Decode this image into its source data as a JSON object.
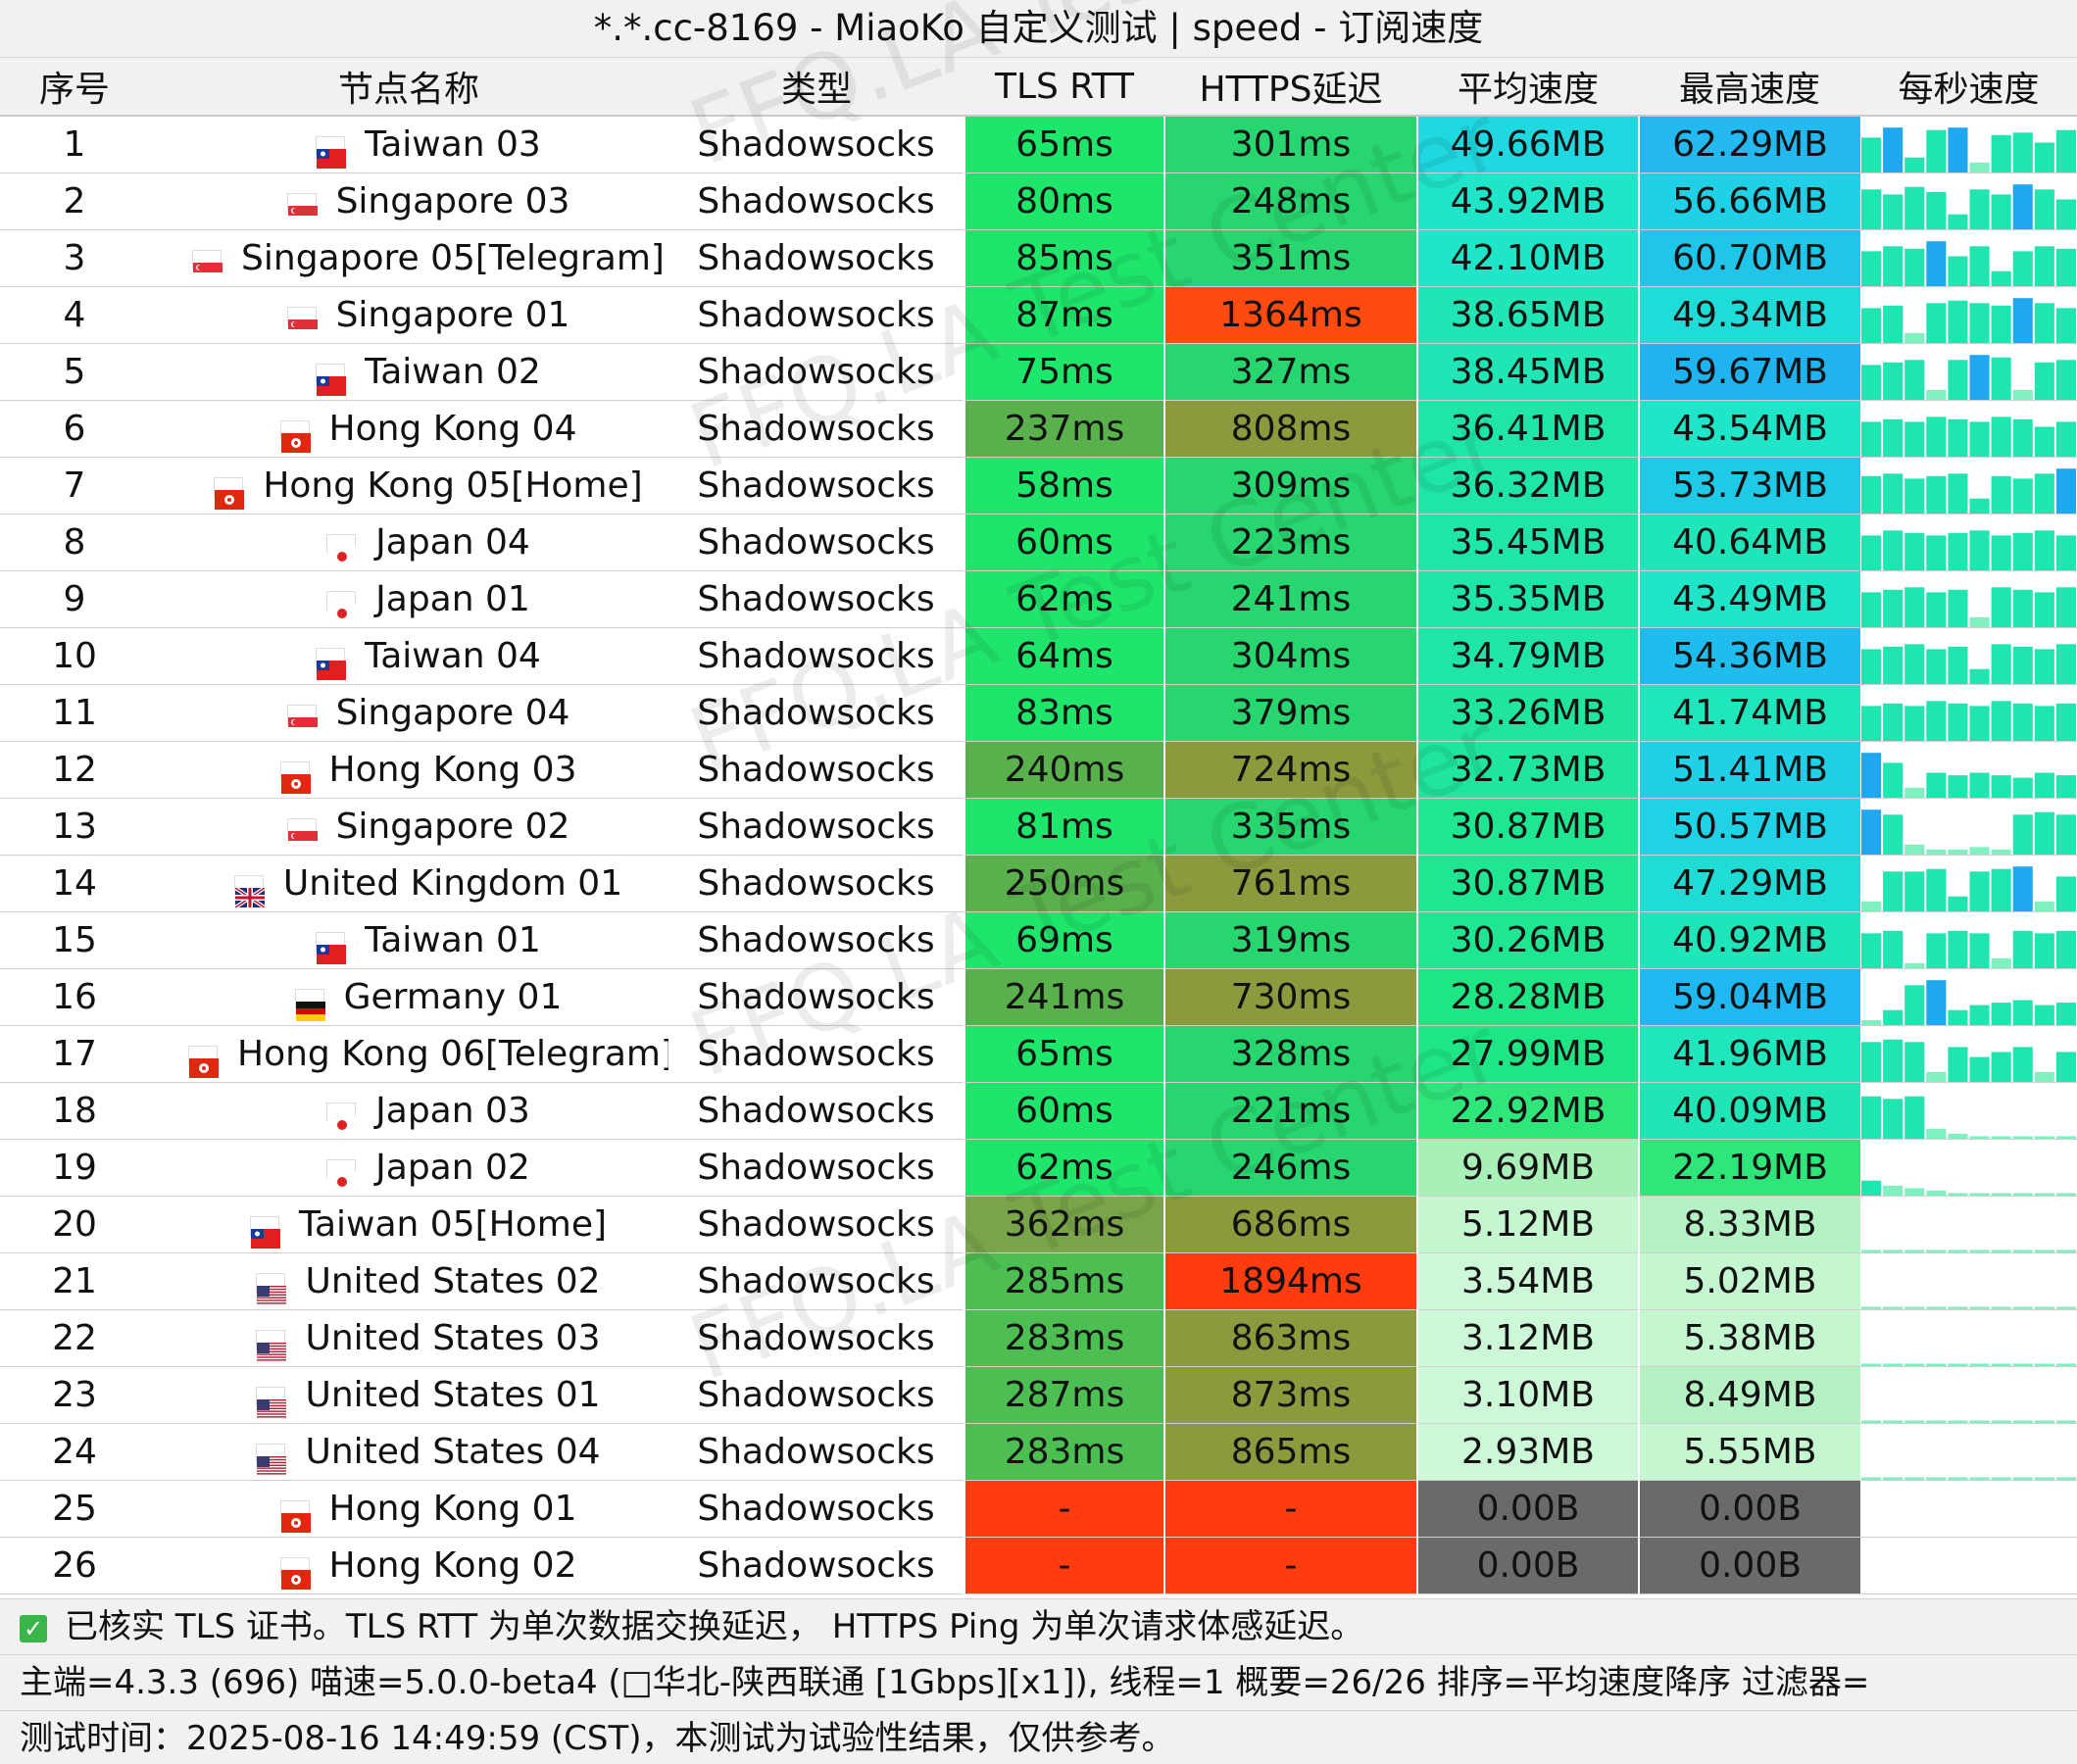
{
  "window": {
    "title": "*.*.cc-8169 - MiaoKo 自定义测试 | speed - 订阅速度"
  },
  "table": {
    "headers": [
      "序号",
      "节点名称",
      "类型",
      "TLS RTT",
      "HTTPS延迟",
      "平均速度",
      "最高速度",
      "每秒速度"
    ],
    "rows": [
      {
        "no": "1",
        "flag": "tw",
        "name": "Taiwan 03",
        "type": "Shadowsocks",
        "tls": "65ms",
        "https": "301ms",
        "avg": "49.66MB",
        "max": "62.29MB",
        "tls_color": "#1ee66b",
        "https_color": "#27d66e",
        "avg_color": "#1fd8e0",
        "max_color": "#24b9f0",
        "spark": [
          0.7,
          0.9,
          0.3,
          0.85,
          0.9,
          0.2,
          0.75,
          0.8,
          0.6,
          0.85
        ]
      },
      {
        "no": "2",
        "flag": "sg",
        "name": "Singapore 03",
        "type": "Shadowsocks",
        "tls": "80ms",
        "https": "248ms",
        "avg": "43.92MB",
        "max": "56.66MB",
        "tls_color": "#1ee66b",
        "https_color": "#27d66e",
        "avg_color": "#1fe6c8",
        "max_color": "#1fd0e6",
        "spark": [
          0.8,
          0.7,
          0.85,
          0.75,
          0.3,
          0.8,
          0.7,
          0.9,
          0.8,
          0.6
        ]
      },
      {
        "no": "3",
        "flag": "sg",
        "name": "Singapore 05[Telegram]",
        "type": "Shadowsocks",
        "tls": "85ms",
        "https": "351ms",
        "avg": "42.10MB",
        "max": "60.70MB",
        "tls_color": "#1ee66b",
        "https_color": "#27d66e",
        "avg_color": "#1fe6c8",
        "max_color": "#1fc6ea",
        "spark": [
          0.7,
          0.8,
          0.75,
          0.9,
          0.6,
          0.8,
          0.3,
          0.7,
          0.8,
          0.75
        ]
      },
      {
        "no": "4",
        "flag": "sg",
        "name": "Singapore 01",
        "type": "Shadowsocks",
        "tls": "87ms",
        "https": "1364ms",
        "avg": "38.65MB",
        "max": "49.34MB",
        "tls_color": "#1ee66b",
        "https_color": "#ff4a10",
        "avg_color": "#1fe6b4",
        "max_color": "#1fdcd8",
        "spark": [
          0.7,
          0.75,
          0.2,
          0.8,
          0.85,
          0.8,
          0.75,
          0.9,
          0.8,
          0.7
        ]
      },
      {
        "no": "5",
        "flag": "tw",
        "name": "Taiwan 02",
        "type": "Shadowsocks",
        "tls": "75ms",
        "https": "327ms",
        "avg": "38.45MB",
        "max": "59.67MB",
        "tls_color": "#1ee66b",
        "https_color": "#27d66e",
        "avg_color": "#1fe6b4",
        "max_color": "#1fb4f0",
        "spark": [
          0.7,
          0.75,
          0.8,
          0.2,
          0.8,
          0.9,
          0.85,
          0.2,
          0.75,
          0.8
        ]
      },
      {
        "no": "6",
        "flag": "hk",
        "name": "Hong Kong 04",
        "type": "Shadowsocks",
        "tls": "237ms",
        "https": "808ms",
        "avg": "36.41MB",
        "max": "43.54MB",
        "tls_color": "#5ab04c",
        "https_color": "#8c9a3e",
        "avg_color": "#1fe6a8",
        "max_color": "#1fe6c8",
        "spark": [
          0.7,
          0.75,
          0.7,
          0.8,
          0.75,
          0.7,
          0.8,
          0.75,
          0.6,
          0.7
        ]
      },
      {
        "no": "7",
        "flag": "hk",
        "name": "Hong Kong 05[Home]",
        "type": "Shadowsocks",
        "tls": "58ms",
        "https": "309ms",
        "avg": "36.32MB",
        "max": "53.73MB",
        "tls_color": "#1ee66b",
        "https_color": "#27d66e",
        "avg_color": "#1fe6a8",
        "max_color": "#1fcae6",
        "spark": [
          0.75,
          0.8,
          0.7,
          0.75,
          0.8,
          0.3,
          0.75,
          0.7,
          0.8,
          0.9
        ]
      },
      {
        "no": "8",
        "flag": "jp",
        "name": "Japan 04",
        "type": "Shadowsocks",
        "tls": "60ms",
        "https": "223ms",
        "avg": "35.45MB",
        "max": "40.64MB",
        "tls_color": "#1ee66b",
        "https_color": "#27d66e",
        "avg_color": "#1fe6a8",
        "max_color": "#1fe6b8",
        "spark": [
          0.7,
          0.8,
          0.75,
          0.7,
          0.75,
          0.8,
          0.7,
          0.75,
          0.8,
          0.7
        ]
      },
      {
        "no": "9",
        "flag": "jp",
        "name": "Japan 01",
        "type": "Shadowsocks",
        "tls": "62ms",
        "https": "241ms",
        "avg": "35.35MB",
        "max": "43.49MB",
        "tls_color": "#1ee66b",
        "https_color": "#27d66e",
        "avg_color": "#1fe6a8",
        "max_color": "#1fe6c8",
        "spark": [
          0.7,
          0.75,
          0.8,
          0.7,
          0.75,
          0.2,
          0.8,
          0.75,
          0.7,
          0.8
        ]
      },
      {
        "no": "10",
        "flag": "tw",
        "name": "Taiwan 04",
        "type": "Shadowsocks",
        "tls": "64ms",
        "https": "304ms",
        "avg": "34.79MB",
        "max": "54.36MB",
        "tls_color": "#1ee66b",
        "https_color": "#27d66e",
        "avg_color": "#1fe6a8",
        "max_color": "#1fbcee",
        "spark": [
          0.7,
          0.75,
          0.8,
          0.7,
          0.75,
          0.3,
          0.8,
          0.75,
          0.7,
          0.8
        ]
      },
      {
        "no": "11",
        "flag": "sg",
        "name": "Singapore 04",
        "type": "Shadowsocks",
        "tls": "83ms",
        "https": "379ms",
        "avg": "33.26MB",
        "max": "41.74MB",
        "tls_color": "#1ee66b",
        "https_color": "#27d66e",
        "avg_color": "#1fe69c",
        "max_color": "#1fe6bc",
        "spark": [
          0.7,
          0.75,
          0.7,
          0.8,
          0.75,
          0.7,
          0.8,
          0.75,
          0.7,
          0.75
        ]
      },
      {
        "no": "12",
        "flag": "hk",
        "name": "Hong Kong 03",
        "type": "Shadowsocks",
        "tls": "240ms",
        "https": "724ms",
        "avg": "32.73MB",
        "max": "51.41MB",
        "tls_color": "#5ab04c",
        "https_color": "#8c9a3e",
        "avg_color": "#1fe69c",
        "max_color": "#1fd0e6",
        "spark": [
          0.9,
          0.7,
          0.2,
          0.5,
          0.45,
          0.5,
          0.45,
          0.4,
          0.5,
          0.45
        ]
      },
      {
        "no": "13",
        "flag": "sg",
        "name": "Singapore 02",
        "type": "Shadowsocks",
        "tls": "81ms",
        "https": "335ms",
        "avg": "30.87MB",
        "max": "50.57MB",
        "tls_color": "#1ee66b",
        "https_color": "#27d66e",
        "avg_color": "#1fe690",
        "max_color": "#1fd2e6",
        "spark": [
          0.9,
          0.8,
          0.2,
          0.1,
          0.1,
          0.15,
          0.1,
          0.8,
          0.85,
          0.8
        ]
      },
      {
        "no": "14",
        "flag": "uk",
        "name": "United Kingdom 01",
        "type": "Shadowsocks",
        "tls": "250ms",
        "https": "761ms",
        "avg": "30.87MB",
        "max": "47.29MB",
        "tls_color": "#5ab04c",
        "https_color": "#8c9a3e",
        "avg_color": "#1fe690",
        "max_color": "#1fdcd4",
        "spark": [
          0.2,
          0.8,
          0.8,
          0.85,
          0.3,
          0.8,
          0.85,
          0.9,
          0.2,
          0.7
        ]
      },
      {
        "no": "15",
        "flag": "tw",
        "name": "Taiwan 01",
        "type": "Shadowsocks",
        "tls": "69ms",
        "https": "319ms",
        "avg": "30.26MB",
        "max": "40.92MB",
        "tls_color": "#1ee66b",
        "https_color": "#27d66e",
        "avg_color": "#1fe690",
        "max_color": "#1fe6b8",
        "spark": [
          0.7,
          0.75,
          0.1,
          0.7,
          0.75,
          0.7,
          0.2,
          0.75,
          0.7,
          0.75
        ]
      },
      {
        "no": "16",
        "flag": "de",
        "name": "Germany 01",
        "type": "Shadowsocks",
        "tls": "241ms",
        "https": "730ms",
        "avg": "28.28MB",
        "max": "59.04MB",
        "tls_color": "#5ab04c",
        "https_color": "#8c9a3e",
        "avg_color": "#1fe684",
        "max_color": "#1fb8f0",
        "spark": [
          0.1,
          0.3,
          0.8,
          0.9,
          0.3,
          0.4,
          0.45,
          0.5,
          0.4,
          0.45
        ]
      },
      {
        "no": "17",
        "flag": "hk",
        "name": "Hong Kong 06[Telegram]",
        "type": "Shadowsocks",
        "tls": "65ms",
        "https": "328ms",
        "avg": "27.99MB",
        "max": "41.96MB",
        "tls_color": "#1ee66b",
        "https_color": "#27d66e",
        "avg_color": "#1fe684",
        "max_color": "#1fe6bc",
        "spark": [
          0.8,
          0.85,
          0.8,
          0.2,
          0.7,
          0.5,
          0.6,
          0.7,
          0.2,
          0.6
        ]
      },
      {
        "no": "18",
        "flag": "jp",
        "name": "Japan 03",
        "type": "Shadowsocks",
        "tls": "60ms",
        "https": "221ms",
        "avg": "22.92MB",
        "max": "40.09MB",
        "tls_color": "#1ee66b",
        "https_color": "#27d66e",
        "avg_color": "#2fe67a",
        "max_color": "#1fe6b4",
        "spark": [
          0.85,
          0.8,
          0.85,
          0.2,
          0.1,
          0.05,
          0.05,
          0.05,
          0.05,
          0.05
        ]
      },
      {
        "no": "19",
        "flag": "jp",
        "name": "Japan 02",
        "type": "Shadowsocks",
        "tls": "62ms",
        "https": "246ms",
        "avg": "9.69MB",
        "max": "22.19MB",
        "tls_color": "#1ee66b",
        "https_color": "#27d66e",
        "avg_color": "#a8f0b8",
        "max_color": "#2fe67a",
        "spark": [
          0.3,
          0.2,
          0.15,
          0.1,
          0.05,
          0.05,
          0.05,
          0.05,
          0.05,
          0.05
        ]
      },
      {
        "no": "20",
        "flag": "tw",
        "name": "Taiwan 05[Home]",
        "type": "Shadowsocks",
        "tls": "362ms",
        "https": "686ms",
        "avg": "5.12MB",
        "max": "8.33MB",
        "tls_color": "#7aa44a",
        "https_color": "#8c9a3e",
        "avg_color": "#c4f6d0",
        "max_color": "#b4f2c4",
        "spark": [
          0.05,
          0.05,
          0.05,
          0.05,
          0.05,
          0.05,
          0.05,
          0.05,
          0.05,
          0.05
        ]
      },
      {
        "no": "21",
        "flag": "us",
        "name": "United States 02",
        "type": "Shadowsocks",
        "tls": "285ms",
        "https": "1894ms",
        "avg": "3.54MB",
        "max": "5.02MB",
        "tls_color": "#4cbe52",
        "https_color": "#ff3c10",
        "avg_color": "#cdf8d8",
        "max_color": "#c4f6d0",
        "spark": [
          0.05,
          0.05,
          0.05,
          0.05,
          0.05,
          0.05,
          0.05,
          0.05,
          0.05,
          0.05
        ]
      },
      {
        "no": "22",
        "flag": "us",
        "name": "United States 03",
        "type": "Shadowsocks",
        "tls": "283ms",
        "https": "863ms",
        "avg": "3.12MB",
        "max": "5.38MB",
        "tls_color": "#4cbe52",
        "https_color": "#8c9a3e",
        "avg_color": "#cdf8d8",
        "max_color": "#c4f6d0",
        "spark": [
          0.05,
          0.05,
          0.05,
          0.05,
          0.05,
          0.05,
          0.05,
          0.05,
          0.05,
          0.05
        ]
      },
      {
        "no": "23",
        "flag": "us",
        "name": "United States 01",
        "type": "Shadowsocks",
        "tls": "287ms",
        "https": "873ms",
        "avg": "3.10MB",
        "max": "8.49MB",
        "tls_color": "#4cbe52",
        "https_color": "#8c9a3e",
        "avg_color": "#cdf8d8",
        "max_color": "#b4f2c4",
        "spark": [
          0.05,
          0.05,
          0.05,
          0.05,
          0.05,
          0.05,
          0.05,
          0.05,
          0.05,
          0.05
        ]
      },
      {
        "no": "24",
        "flag": "us",
        "name": "United States 04",
        "type": "Shadowsocks",
        "tls": "283ms",
        "https": "865ms",
        "avg": "2.93MB",
        "max": "5.55MB",
        "tls_color": "#4cbe52",
        "https_color": "#8c9a3e",
        "avg_color": "#cdf8d8",
        "max_color": "#c4f6d0",
        "spark": [
          0.05,
          0.05,
          0.05,
          0.05,
          0.05,
          0.05,
          0.05,
          0.05,
          0.05,
          0.05
        ]
      },
      {
        "no": "25",
        "flag": "hk",
        "name": "Hong Kong 01",
        "type": "Shadowsocks",
        "tls": "-",
        "https": "-",
        "avg": "0.00B",
        "max": "0.00B",
        "tls_color": "#ff3c10",
        "https_color": "#ff3c10",
        "avg_color": "#6a6a6a",
        "max_color": "#6a6a6a",
        "spark": []
      },
      {
        "no": "26",
        "flag": "hk",
        "name": "Hong Kong 02",
        "type": "Shadowsocks",
        "tls": "-",
        "https": "-",
        "avg": "0.00B",
        "max": "0.00B",
        "tls_color": "#ff3c10",
        "https_color": "#ff3c10",
        "avg_color": "#6a6a6a",
        "max_color": "#6a6a6a",
        "spark": []
      }
    ]
  },
  "watermark": {
    "text": "FFQ.LA Test Center"
  },
  "footer": {
    "line1": "已核实 TLS 证书。TLS RTT 为单次数据交换延迟， HTTPS Ping 为单次请求体感延迟。",
    "line2": "主端=4.3.3 (696) 喵速=5.0.0-beta4 (□华北-陕西联通 [1Gbps][x1]), 线程=1 概要=26/26 排序=平均速度降序 过滤器=",
    "line3": "测试时间：2025-08-16 14:49:59 (CST)，本测试为试验性结果，仅供参考。"
  },
  "colors": {
    "header_bg": "#f1f1f1",
    "check_green": "#39b54a"
  }
}
